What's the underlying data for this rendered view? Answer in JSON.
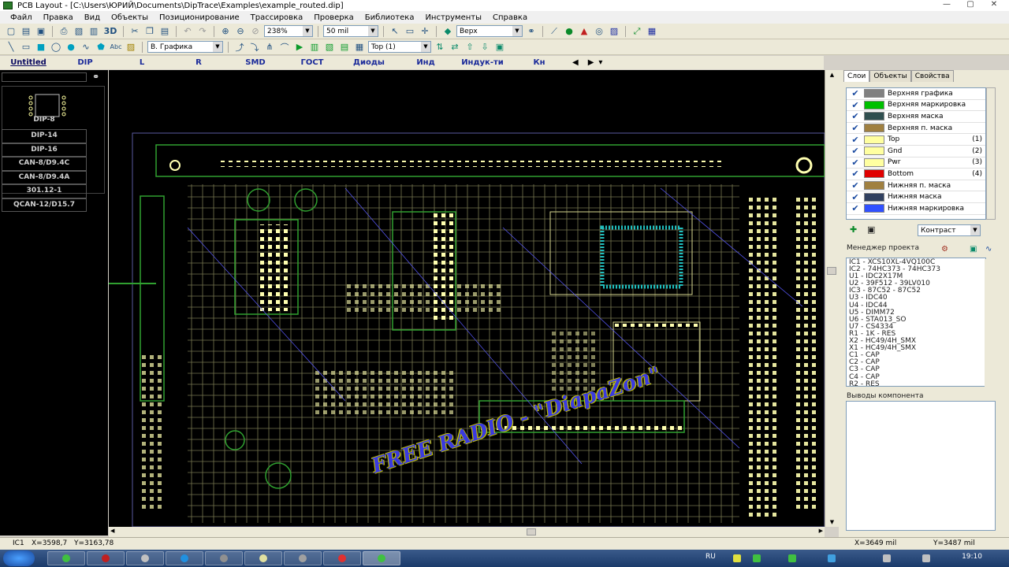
{
  "window": {
    "title": "PCB Layout - [C:\\Users\\ЮРИЙ\\Documents\\DipTrace\\Examples\\example_routed.dip]",
    "buttons": [
      "—",
      "▢",
      "✕"
    ]
  },
  "menu": [
    "Файл",
    "Правка",
    "Вид",
    "Объекты",
    "Позиционирование",
    "Трассировка",
    "Проверка",
    "Библиотека",
    "Инструменты",
    "Справка"
  ],
  "toolbar1": {
    "threed_label": "3D",
    "zoom_value": "238%",
    "grid_value": "50 mil",
    "side_value": "Верх"
  },
  "toolbar2": {
    "layer_type_value": "В. Графика",
    "layer_value": "Top (1)"
  },
  "libraries": {
    "tabs": [
      "Untitled",
      "DIP",
      "L",
      "R",
      "SMD",
      "ГОСТ",
      "Диоды",
      "Инд",
      "Индук-ти",
      "Кн"
    ]
  },
  "components": {
    "items": [
      "DIP-8",
      "DIP-14",
      "DIP-16",
      "CAN-8/D9.4C",
      "CAN-8/D9.4A",
      "301.12-1",
      "QCAN-12/D15.7"
    ]
  },
  "right_tabs": [
    "Слои",
    "Объекты",
    "Свойства"
  ],
  "layers": [
    {
      "name": "Верхняя графика",
      "color": "#808080",
      "num": ""
    },
    {
      "name": "Верхняя маркировка",
      "color": "#00c000",
      "num": ""
    },
    {
      "name": "Верхняя маска",
      "color": "#2f4f4f",
      "num": ""
    },
    {
      "name": "Верхняя п. маска",
      "color": "#a08040",
      "num": ""
    },
    {
      "name": "Top",
      "color": "#ffffa0",
      "num": "(1)"
    },
    {
      "name": "Gnd",
      "color": "#ffffa0",
      "num": "(2)"
    },
    {
      "name": "Pwr",
      "color": "#ffffa0",
      "num": "(3)"
    },
    {
      "name": "Bottom",
      "color": "#e00000",
      "num": "(4)"
    },
    {
      "name": "Нижняя п. маска",
      "color": "#a08040",
      "num": ""
    },
    {
      "name": "Нижняя маска",
      "color": "#304060",
      "num": ""
    },
    {
      "name": "Нижняя маркировка",
      "color": "#3050ff",
      "num": ""
    }
  ],
  "contrast_value": "Контраст",
  "project": {
    "label": "Менеджер проекта",
    "items": [
      "IC1 - XCS10XL-4VQ100C",
      "IC2 - 74HC373 - 74HC373",
      "U1 - IDC2X17M",
      "U2 - 39F512 - 39LV010",
      "IC3 - 87C52 - 87C52",
      "U3 - IDC40",
      "U4 - IDC44",
      "U5 - DIMM72",
      "U6 - STA013_SO",
      "U7 - CS4334",
      "R1 - 1K - RES",
      "X2 - HC49/4H_SMX",
      "X1 - HC49/4H_SMX",
      "C1 - CAP",
      "C2 - CAP",
      "C3 - CAP",
      "C4 - CAP",
      "R2 - RES"
    ]
  },
  "pins_label": "Выводы компонента",
  "status": {
    "component": "IC1",
    "x": "X=3598,7",
    "y": "Y=3163,78",
    "mouse_x": "X=3649 mil",
    "mouse_y": "Y=3487 mil"
  },
  "watermark": "FREE RADIO - \"DiapaZon\"",
  "taskbar": {
    "lang": "RU",
    "clock": "19:10"
  }
}
